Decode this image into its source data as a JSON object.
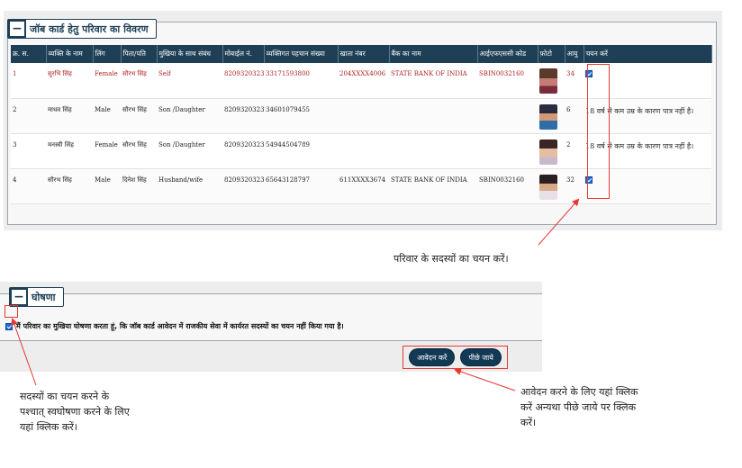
{
  "family_panel": {
    "toggle": "−",
    "title": "जॉब कार्ड हेतु परिवार का विवरण",
    "columns": [
      "क्र. स.",
      "व्यक्ति के नाम",
      "लिंग",
      "पिता/पति",
      "मुखिया के साथ संबंध",
      "मोबाईल नं.",
      "व्यक्तिगत पहचान संख्या",
      "खाता नंबर",
      "बैंक का नाम",
      "आईएफएससी कोड",
      "फ़ोटो",
      "आयु",
      "चयन करें"
    ],
    "rows": [
      {
        "sno": "1",
        "name": "सुरभि सिंह",
        "gender": "Female",
        "father": "सौरभ सिंह",
        "relation": "Self",
        "mobile": "8209320323",
        "uid": "33171593800",
        "account": "204XXXX4006",
        "bank": "STATE BANK OF INDIA",
        "ifsc": "SBIN0032160",
        "age": "34",
        "select_note": "",
        "selected": true
      },
      {
        "sno": "2",
        "name": "माधव सिंह",
        "gender": "Male",
        "father": "सौरभ सिंह",
        "relation": "Son /Daughter",
        "mobile": "8209320323",
        "uid": "34601079455",
        "account": "",
        "bank": "",
        "ifsc": "",
        "age": "6",
        "select_note": "18 वर्ष से कम उम्र के कारण पात्र नहीं है।",
        "selected": false
      },
      {
        "sno": "3",
        "name": "मनस्वी सिंह",
        "gender": "Female",
        "father": "सौरभ सिंह",
        "relation": "Son /Daughter",
        "mobile": "8209320323",
        "uid": "54944504789",
        "account": "",
        "bank": "",
        "ifsc": "",
        "age": "2",
        "select_note": "18 वर्ष से कम उम्र के कारण पात्र नहीं है।",
        "selected": false
      },
      {
        "sno": "4",
        "name": "सौरभ सिंह",
        "gender": "Male",
        "father": "दिनेश सिंह",
        "relation": "Husband/wife",
        "mobile": "8209320323",
        "uid": "65643128797",
        "account": "611XXXX3674",
        "bank": "STATE BANK OF INDIA",
        "ifsc": "SBIN0032160",
        "age": "32",
        "select_note": "",
        "selected": true
      }
    ]
  },
  "declaration_panel": {
    "toggle": "−",
    "title": "घोषणा",
    "text": "मैं परिवार का मुखिया घोषणा करता हूं, कि जॉब कार्ड आवेदन में राजकीय सेवा में कार्यरत सदस्यों का चयन नहीं किया गया है।",
    "checked": true
  },
  "buttons": {
    "apply": "आवेदन करें",
    "back": "पीछे जाये"
  },
  "annotations": {
    "select_members": "परिवार के सदस्यों का चयन करें।",
    "self_declare_lines": [
      "सदस्यों का चयन करने के",
      "पश्चात् स्वघोषणा करने के लिए",
      "यहां क्लिक करें।"
    ],
    "apply_lines": [
      "आवेदन करने के लिए यहां क्लिक",
      "करें अन्यथा पीछे जाये पर क्लिक",
      "करें।"
    ]
  },
  "colors": {
    "header_bg": "#1e3f55",
    "highlight": "#e53935",
    "row1_text": "#b22222",
    "checkbox": "#1a6fd6"
  }
}
